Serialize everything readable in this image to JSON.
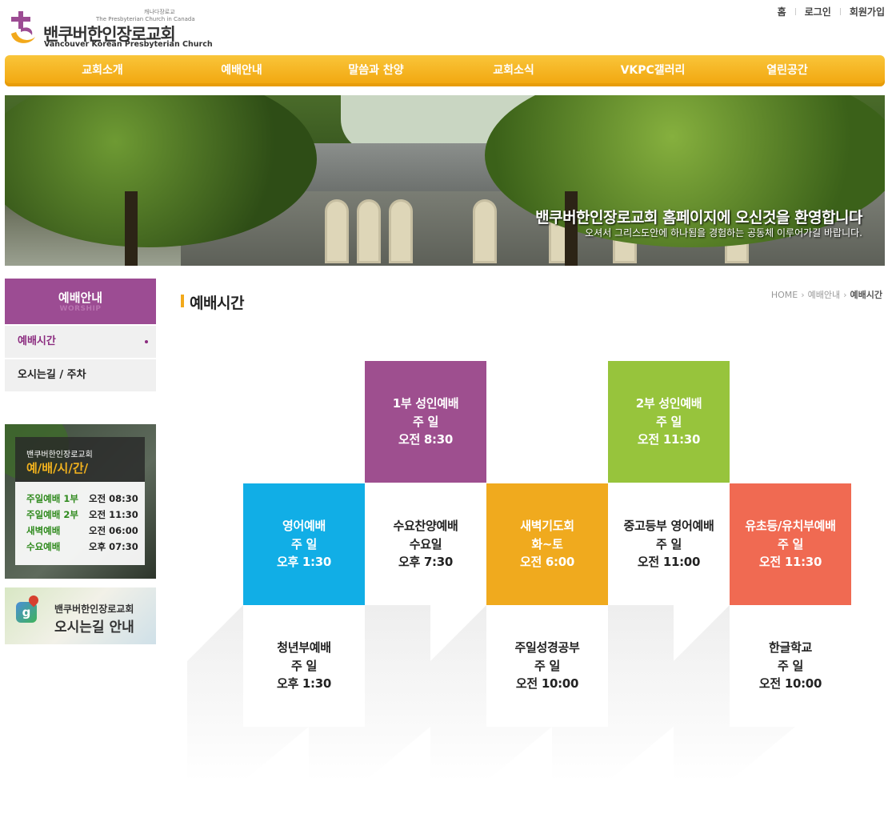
{
  "header": {
    "logo_small1": "캐나다장로교",
    "logo_small2": "The Presbyterian Church in Canada",
    "logo_title": "밴쿠버한인장로교회",
    "logo_sub": "Vancouver Korean Presbyterian Church",
    "util": [
      "홈",
      "로그인",
      "회원가입"
    ]
  },
  "nav": [
    "교회소개",
    "예배안내",
    "말씀과 찬양",
    "교회소식",
    "VKPC갤러리",
    "열린공간"
  ],
  "banner": {
    "title": "밴쿠버한인장로교회 홈페이지에 오신것을 환영합니다",
    "subtitle": "오셔서 그리스도안에 하나됨을 경험하는 공동체 이루어가길 바랍니다."
  },
  "sidebar": {
    "title": "예배안내",
    "title_en": "WORSHIP",
    "items": [
      "예배시간",
      "오시는길 / 주차"
    ],
    "time_card": {
      "church": "밴쿠버한인장로교회",
      "title": "예/배/시/간/",
      "rows": [
        {
          "name": "주일예배 1부",
          "time": "오전 08:30"
        },
        {
          "name": "주일예배 2부",
          "time": "오전 11:30"
        },
        {
          "name": "새벽예배",
          "time": "오전 06:00"
        },
        {
          "name": "수요예배",
          "time": "오후 07:30"
        }
      ]
    },
    "map_card": {
      "line1": "밴쿠버한인장로교회",
      "line2": "오시는길 안내"
    }
  },
  "content": {
    "title": "예배시간",
    "breadcrumb": [
      "HOME",
      "예배안내",
      "예배시간"
    ],
    "services": [
      {
        "name": "1부 성인예배",
        "day": "주 일",
        "time": "오전 8:30",
        "color": "#9e4f8f"
      },
      {
        "name": "2부 성인예배",
        "day": "주 일",
        "time": "오전 11:30",
        "color": "#97c43c"
      },
      {
        "name": "영어예배",
        "day": "주 일",
        "time": "오후 1:30",
        "color": "#11aee6"
      },
      {
        "name": "수요찬양예배",
        "day": "수요일",
        "time": "오후 7:30",
        "color": "#ffffff"
      },
      {
        "name": "새벽기도회",
        "day": "화~토",
        "time": "오전 6:00",
        "color": "#f0aa1e"
      },
      {
        "name": "중고등부 영어예배",
        "day": "주 일",
        "time": "오전 11:00",
        "color": "#ffffff"
      },
      {
        "name": "유초등/유치부예배",
        "day": "주 일",
        "time": "오전 11:30",
        "color": "#f06a52"
      },
      {
        "name": "청년부예배",
        "day": "주 일",
        "time": "오후 1:30",
        "color": "#ffffff"
      },
      {
        "name": "주일성경공부",
        "day": "주 일",
        "time": "오전 10:00",
        "color": "#ffffff"
      },
      {
        "name": "한글학교",
        "day": "주 일",
        "time": "오전 10:00",
        "color": "#ffffff"
      }
    ]
  },
  "colors": {
    "nav_gold": "#f5b324",
    "purple": "#9c4c93",
    "accent_bar": "#f2a91b"
  }
}
